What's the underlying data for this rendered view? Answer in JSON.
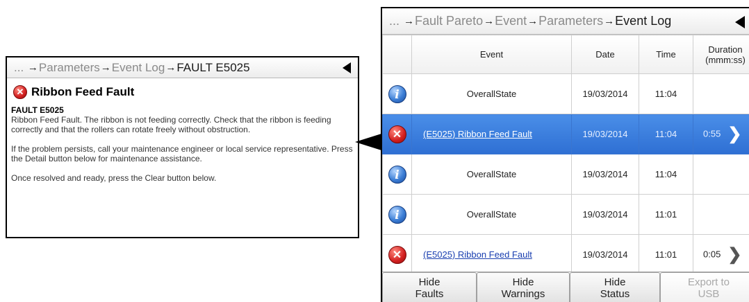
{
  "fault_panel": {
    "breadcrumb": [
      {
        "label": "...",
        "current": false
      },
      {
        "label": "Parameters",
        "current": false
      },
      {
        "label": "Event Log",
        "current": false
      },
      {
        "label": "FAULT E5025",
        "current": true
      }
    ],
    "title": "Ribbon Feed Fault",
    "code": "FAULT E5025",
    "paragraphs": [
      "Ribbon Feed Fault. The ribbon is not feeding correctly. Check that the ribbon is feeding correctly and that the rollers can rotate freely without obstruction.",
      "If the problem persists, call your maintenance engineer or local service representative. Press the Detail button below for maintenance assistance.",
      "Once resolved and ready, press the Clear button below."
    ]
  },
  "log_panel": {
    "breadcrumb": [
      {
        "label": "...",
        "current": false
      },
      {
        "label": "Fault Pareto",
        "current": false
      },
      {
        "label": "Event",
        "current": false
      },
      {
        "label": "Parameters",
        "current": false
      },
      {
        "label": "Event Log",
        "current": true
      }
    ],
    "columns": {
      "event": "Event",
      "date": "Date",
      "time": "Time",
      "duration_line1": "Duration",
      "duration_line2": "(mmm:ss)"
    },
    "rows": [
      {
        "type": "info",
        "event": "OverallState",
        "link": false,
        "date": "19/03/2014",
        "time": "11:04",
        "duration": "",
        "selected": false
      },
      {
        "type": "fault",
        "event": "(E5025) Ribbon Feed Fault",
        "link": true,
        "date": "19/03/2014",
        "time": "11:04",
        "duration": "0:55",
        "selected": true
      },
      {
        "type": "info",
        "event": "OverallState",
        "link": false,
        "date": "19/03/2014",
        "time": "11:04",
        "duration": "",
        "selected": false
      },
      {
        "type": "info",
        "event": "OverallState",
        "link": false,
        "date": "19/03/2014",
        "time": "11:01",
        "duration": "",
        "selected": false
      },
      {
        "type": "fault",
        "event": "(E5025) Ribbon Feed Fault",
        "link": true,
        "date": "19/03/2014",
        "time": "11:01",
        "duration": "0:05",
        "selected": false
      }
    ],
    "buttons": [
      {
        "line1": "Hide",
        "line2": "Faults",
        "enabled": true,
        "name": "hide-faults-button"
      },
      {
        "line1": "Hide",
        "line2": "Warnings",
        "enabled": true,
        "name": "hide-warnings-button"
      },
      {
        "line1": "Hide",
        "line2": "Status",
        "enabled": true,
        "name": "hide-status-button"
      },
      {
        "line1": "Export to",
        "line2": "USB",
        "enabled": false,
        "name": "export-usb-button"
      }
    ]
  },
  "icons": {
    "arrow": "→",
    "error_glyph": "✕",
    "info_glyph": "i",
    "chevron": "❯"
  },
  "colors": {
    "selected_row": "#3b7fe0",
    "fault_red": "#d21f1f",
    "info_blue": "#3d7fd6"
  }
}
